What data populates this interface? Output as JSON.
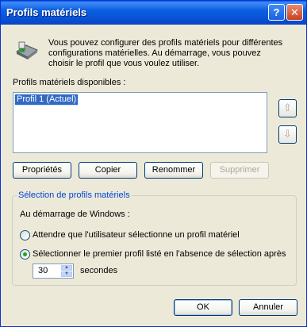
{
  "window": {
    "title": "Profils matériels",
    "help_button": "?",
    "close_button": "✕"
  },
  "info": {
    "text": "Vous pouvez configurer des profils matériels pour différentes configurations matérielles. Au démarrage, vous pouvez choisir le profil que vous voulez utiliser."
  },
  "profiles": {
    "label": "Profils matériels disponibles :",
    "items": [
      "Profil 1 (Actuel)"
    ],
    "move_up": "⇧",
    "move_down": "⇩"
  },
  "buttons": {
    "properties": "Propriétés",
    "copy": "Copier",
    "rename": "Renommer",
    "delete": "Supprimer"
  },
  "selection": {
    "group_title": "Sélection de profils matériels",
    "startup_label": "Au démarrage de Windows :",
    "option_wait": "Attendre que l'utilisateur sélectionne un profil matériel",
    "option_first": "Sélectionner le premier profil listé en l'absence de sélection après",
    "selected_option": "first",
    "seconds_value": "30",
    "seconds_label": "secondes"
  },
  "footer": {
    "ok": "OK",
    "cancel": "Annuler"
  }
}
